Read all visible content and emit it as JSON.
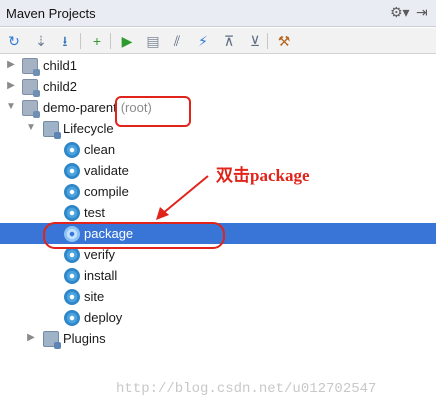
{
  "panel": {
    "title": "Maven Projects",
    "settings_icon": "⚙▾",
    "hide_icon": "⇥"
  },
  "toolbar": {
    "items": [
      {
        "name": "reimport-icon",
        "glyph": "↻",
        "color": "#2d7ad6"
      },
      {
        "name": "generate-sources-icon",
        "glyph": "⇣",
        "color": "#6d7f96"
      },
      {
        "name": "download-icon",
        "glyph": "⭳",
        "color": "#2d6fb8"
      },
      {
        "name": "add-icon",
        "glyph": "+",
        "color": "#2f9a2f"
      },
      {
        "name": "run-icon",
        "glyph": "▶",
        "color": "#2f9a2f"
      },
      {
        "name": "execute-goal-icon",
        "glyph": "▤",
        "color": "#7d8896"
      },
      {
        "name": "toggle-offline-icon",
        "glyph": "⫽",
        "color": "#5c6c80"
      },
      {
        "name": "skip-tests-icon",
        "glyph": "⚡",
        "color": "#2d7ad6"
      },
      {
        "name": "collapse-all-icon",
        "glyph": "⊼",
        "color": "#5c6c80"
      },
      {
        "name": "expand-all-icon",
        "glyph": "⊻",
        "color": "#5c6c80"
      },
      {
        "name": "maven-settings-icon",
        "glyph": "⚒",
        "color": "#b5651d"
      }
    ]
  },
  "tree": {
    "child1": "child1",
    "child2": "child2",
    "demo_parent": "demo-parent",
    "root_tag": "(root)",
    "lifecycle": "Lifecycle",
    "goals": [
      "clean",
      "validate",
      "compile",
      "test",
      "package",
      "verify",
      "install",
      "site",
      "deploy"
    ],
    "plugins": "Plugins"
  },
  "annotation": {
    "text": "双击package",
    "color": "#e0241b"
  },
  "watermark": "http://blog.csdn.net/u012702547"
}
